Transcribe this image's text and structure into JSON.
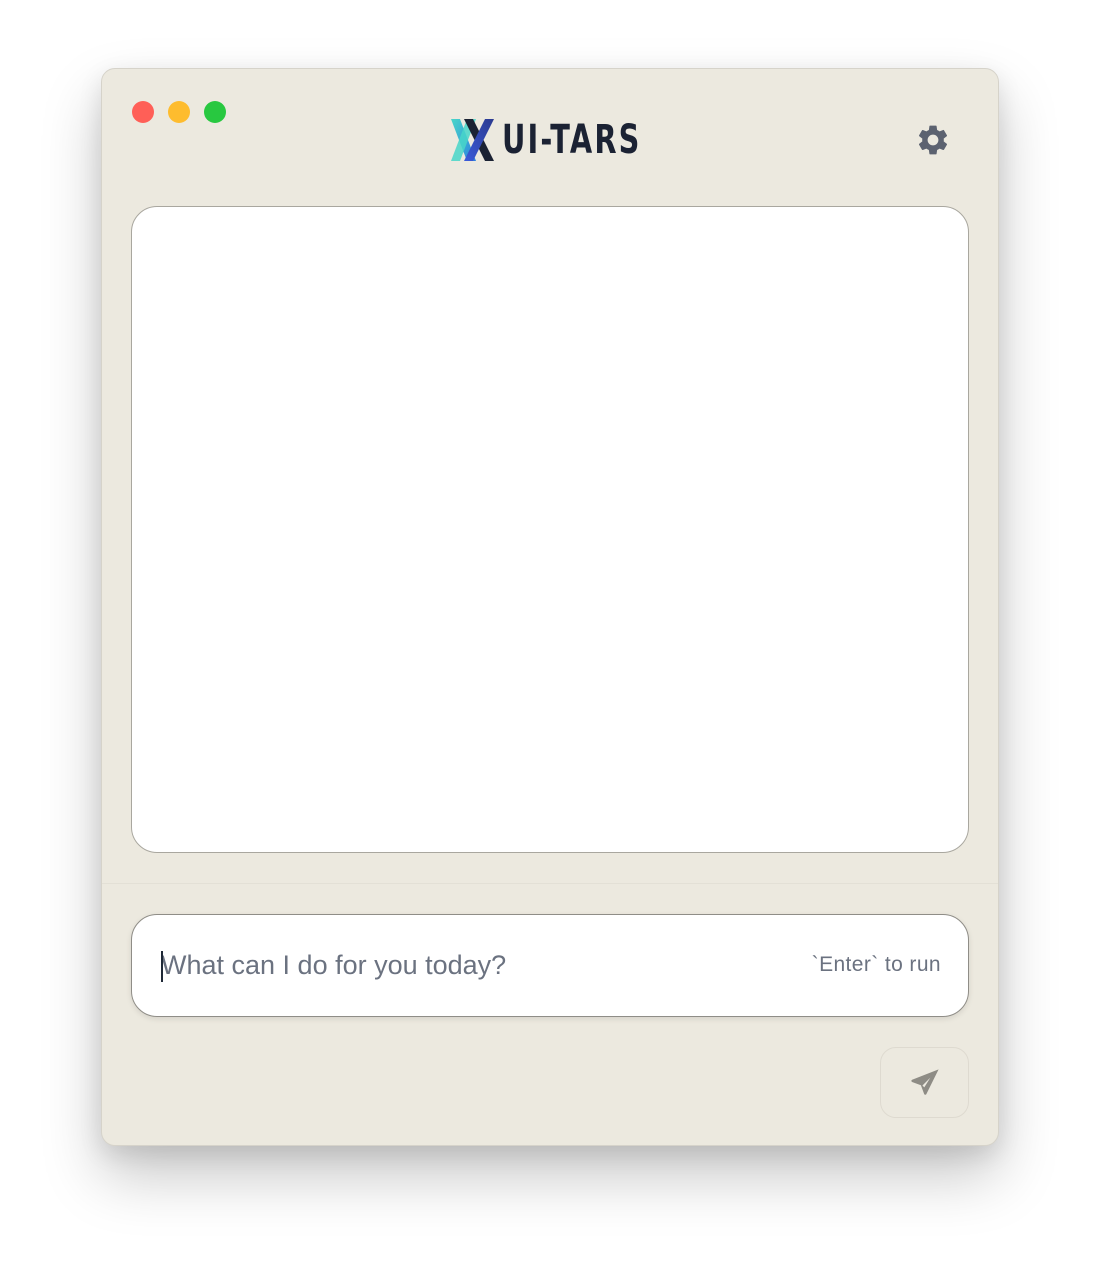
{
  "window": {
    "background": "#ECE9DF",
    "traffic_lights": {
      "close": "#FF5F57",
      "minimize": "#FEBC2E",
      "zoom": "#28C840"
    }
  },
  "header": {
    "logo_icon": "ui-tars-x-logo-icon",
    "title": "UI-TARS",
    "title_color": "#1B2233",
    "settings_icon": "gear-icon",
    "icon_color": "#5C6270"
  },
  "chat": {
    "messages": []
  },
  "composer": {
    "input_value": "",
    "placeholder": "What can I do for you today?",
    "hint": "`Enter` to run",
    "send_icon": "paper-plane-icon",
    "send_icon_color": "#8E8C85"
  }
}
